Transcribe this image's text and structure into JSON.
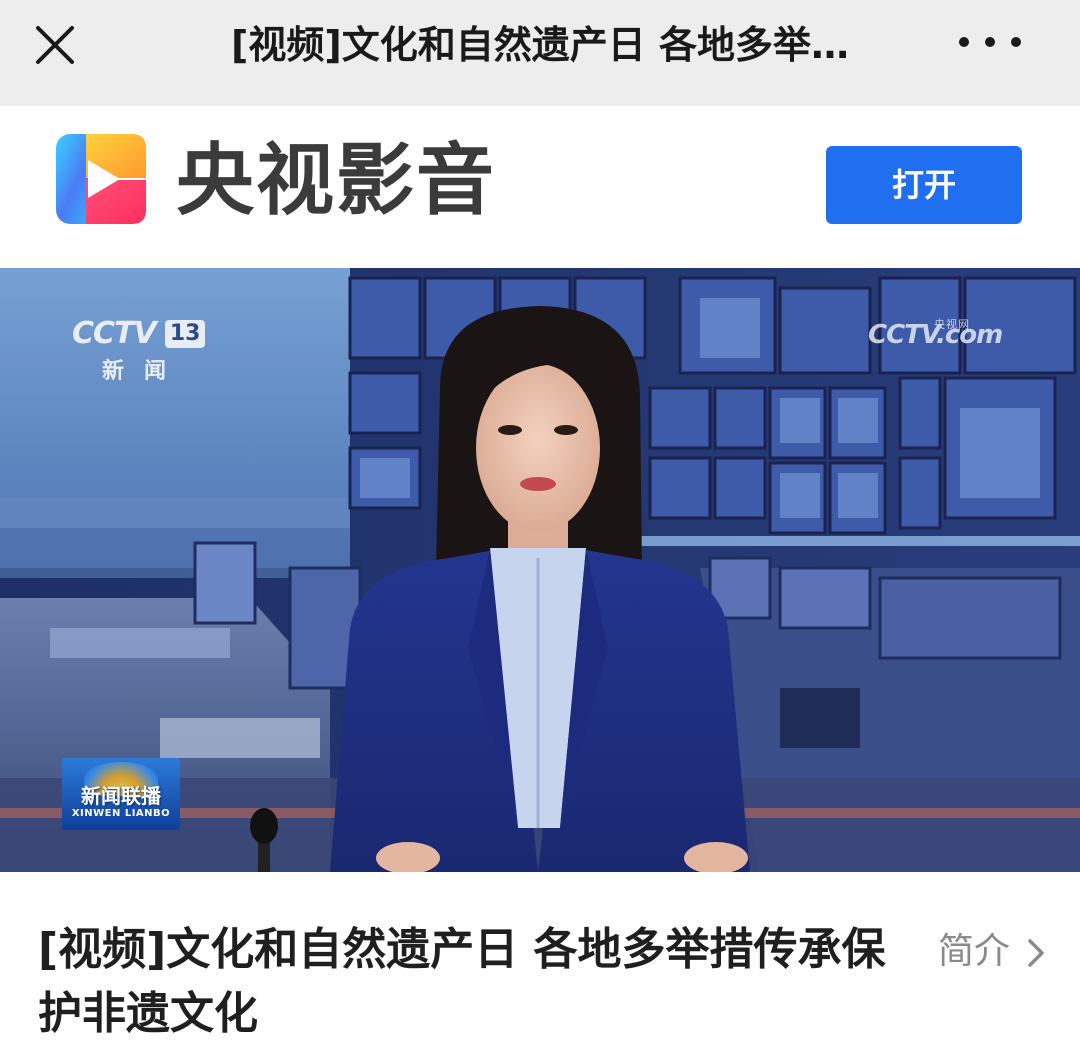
{
  "navbar": {
    "close_icon": "close-icon",
    "title": "[视频]文化和自然遗产日 各地多举…",
    "more_icon": "more-icon"
  },
  "banner": {
    "app_logo_icon": "play-logo-icon",
    "app_name": "央视影音",
    "open_button_label": "打开"
  },
  "video": {
    "channel_logo": {
      "brand": "CCTV",
      "number": "13",
      "channel_name": "新闻"
    },
    "site_watermark": {
      "brand": "CCTV.com",
      "sub": "央视网"
    },
    "program_badge": {
      "cn": "新闻联播",
      "en": "XINWEN LIANBO"
    }
  },
  "article": {
    "title": "[视频]文化和自然遗产日 各地多举措传承保护非遗文化",
    "intro_label": "简介",
    "intro_icon": "chevron-right-icon"
  },
  "colors": {
    "navbar_bg": "#ededed",
    "accent": "#1f6ff0",
    "title_text": "#1f1f1f",
    "secondary_text": "#8a8a8a"
  }
}
